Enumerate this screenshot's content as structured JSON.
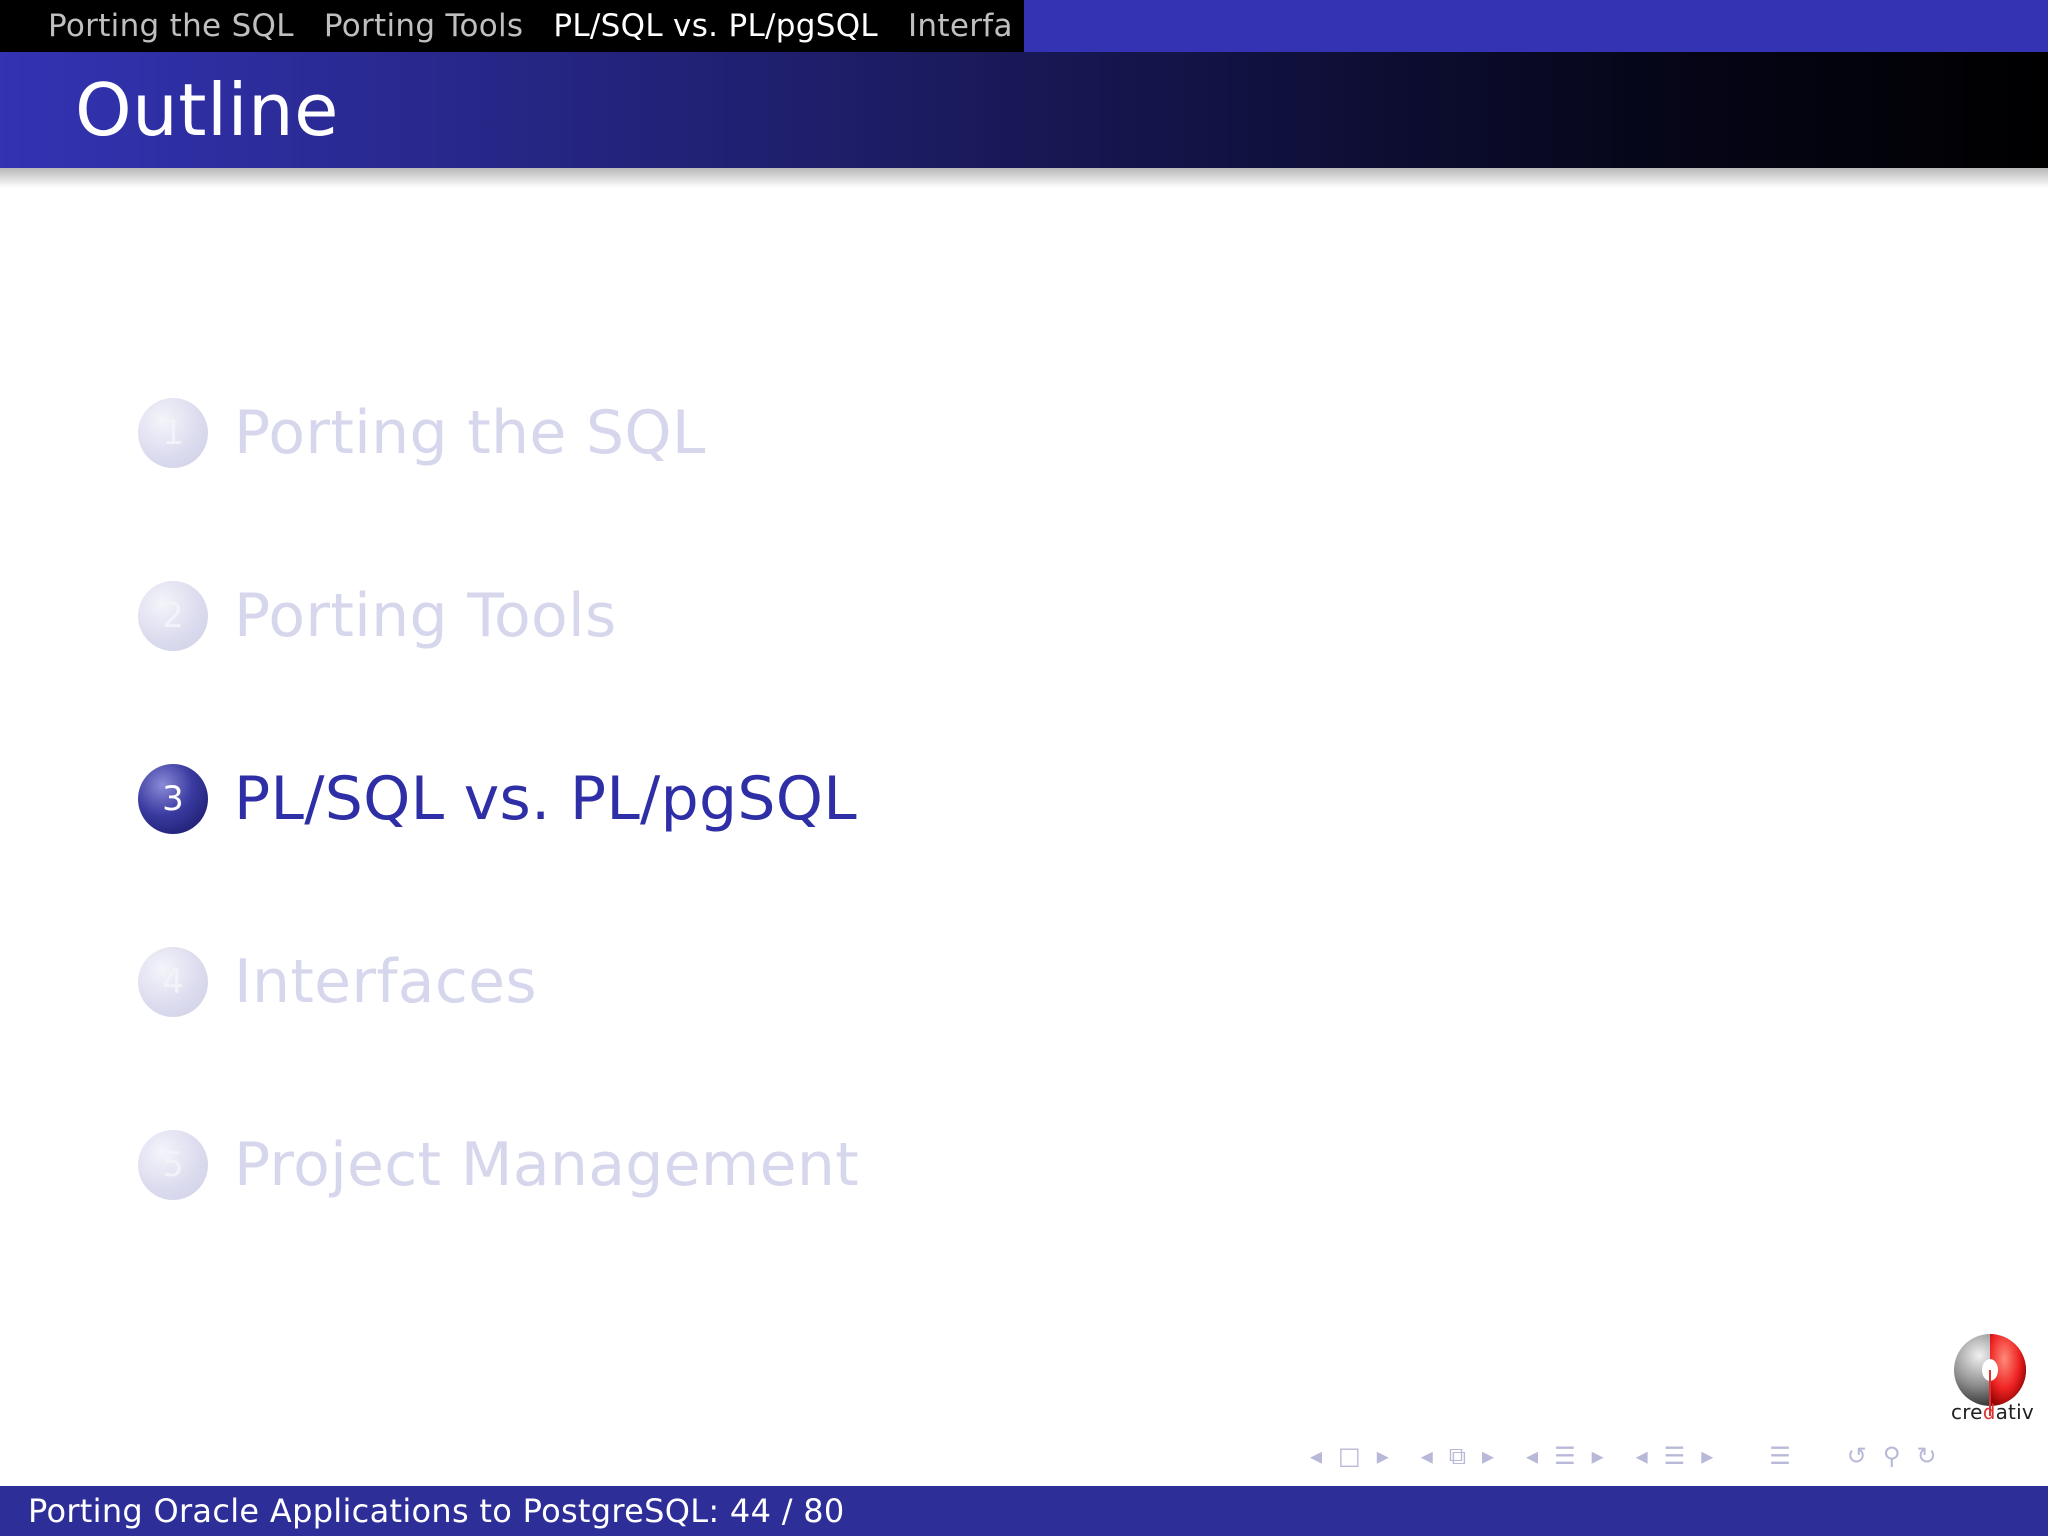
{
  "header": {
    "sections": [
      {
        "label": "Porting the SQL",
        "active": false
      },
      {
        "label": "Porting Tools",
        "active": false
      },
      {
        "label": "PL/SQL vs. PL/pgSQL",
        "active": true
      },
      {
        "label": "Interfa",
        "active": false
      }
    ]
  },
  "frame": {
    "title": "Outline"
  },
  "outline": {
    "items": [
      {
        "number": "1",
        "label": "Porting the SQL",
        "state": "faded"
      },
      {
        "number": "2",
        "label": "Porting Tools",
        "state": "faded"
      },
      {
        "number": "3",
        "label": "PL/SQL vs. PL/pgSQL",
        "state": "current"
      },
      {
        "number": "4",
        "label": "Interfaces",
        "state": "faded"
      },
      {
        "number": "5",
        "label": "Project Management",
        "state": "faded"
      }
    ]
  },
  "logo": {
    "text_a": "cre",
    "text_b": "d",
    "text_c": "ativ"
  },
  "nav_icons": [
    "nav-prev-slide-icon",
    "nav-slide-icon",
    "nav-next-slide-icon",
    "nav-prev-frame-icon",
    "nav-frame-icon",
    "nav-next-frame-icon",
    "nav-prev-subsection-icon",
    "nav-subsection-icon",
    "nav-next-subsection-icon",
    "nav-prev-section-icon",
    "nav-section-icon",
    "nav-next-section-icon",
    "nav-document-icon",
    "nav-back-icon",
    "nav-search-icon",
    "nav-forward-icon"
  ],
  "footer": {
    "text": "Porting Oracle Applications to PostgreSQL: 44 / 80"
  },
  "colors": {
    "theme_blue": "#3333b3",
    "footer_blue": "#2e2e99",
    "faded": "#d6d6ec",
    "current": "#2e2ea6"
  }
}
